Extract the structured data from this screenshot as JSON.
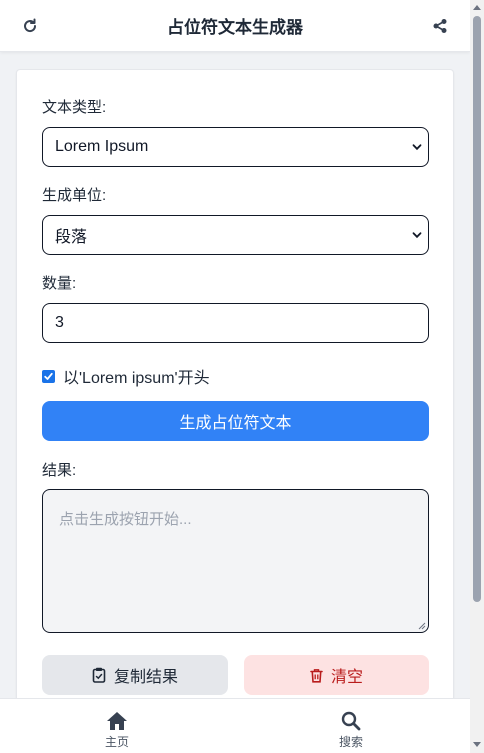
{
  "header": {
    "title": "占位符文本生成器",
    "refresh_icon": "refresh-icon",
    "share_icon": "share-icon"
  },
  "form": {
    "text_type_label": "文本类型:",
    "text_type_value": "Lorem Ipsum",
    "unit_label": "生成单位:",
    "unit_value": "段落",
    "count_label": "数量:",
    "count_value": "3",
    "start_checkbox_label": "以'Lorem ipsum'开头",
    "start_checkbox_checked": true,
    "generate_label": "生成占位符文本",
    "result_label": "结果:",
    "result_placeholder": "点击生成按钮开始...",
    "copy_label": "复制结果",
    "clear_label": "清空"
  },
  "nav": {
    "home_label": "主页",
    "search_label": "搜索"
  },
  "colors": {
    "accent": "#3182f6",
    "danger_bg": "#fde2e2",
    "danger_text": "#b91c1c"
  }
}
